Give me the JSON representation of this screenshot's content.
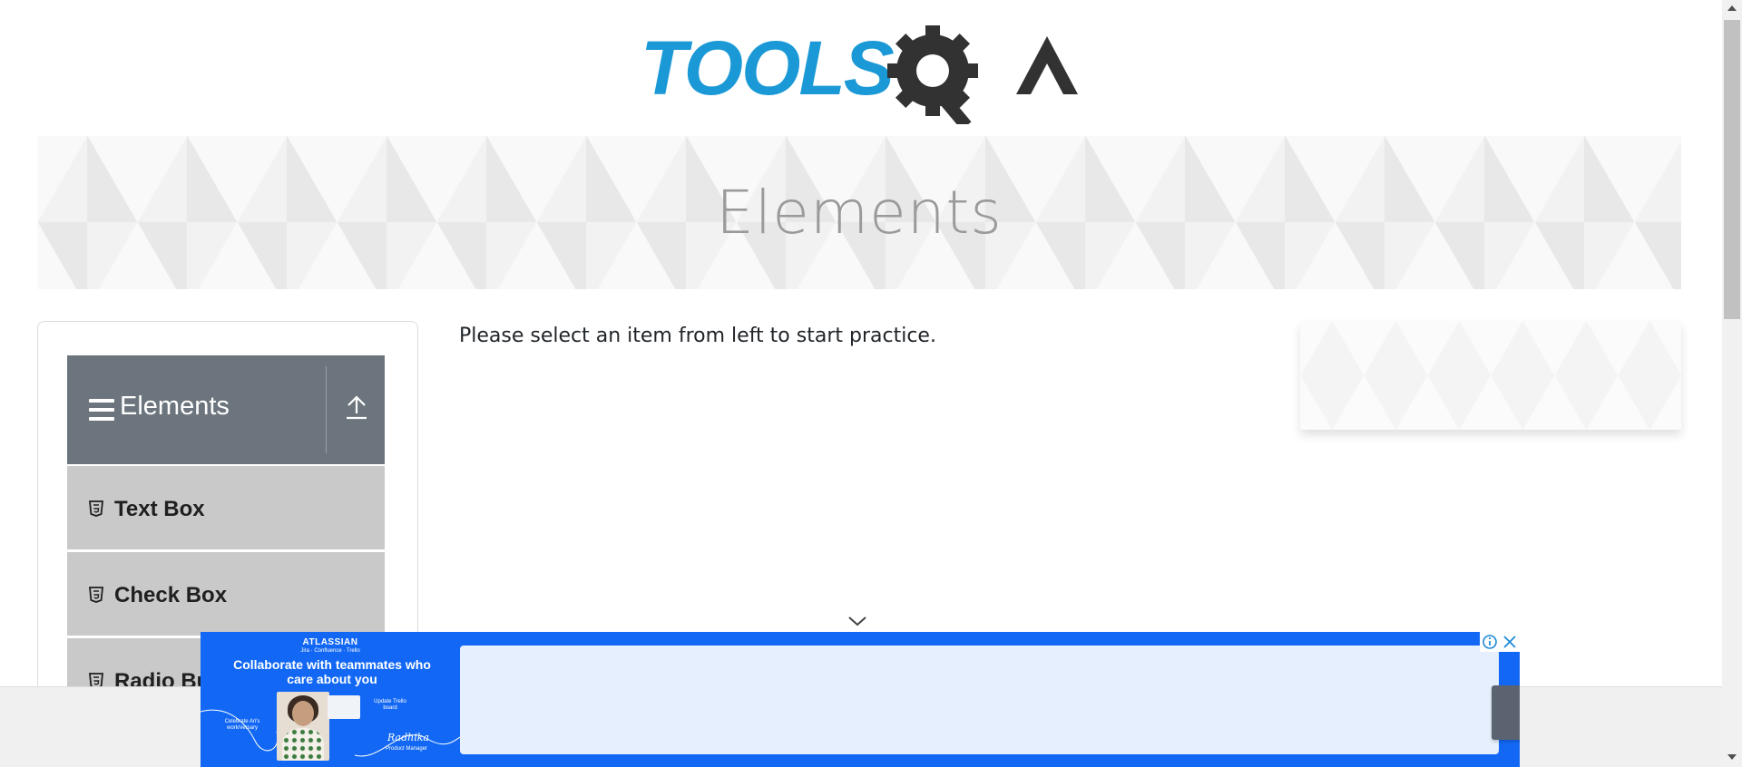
{
  "header": {
    "logo_text": "TOOLSQA"
  },
  "banner": {
    "title": "Elements"
  },
  "sidebar": {
    "group": {
      "title": "Elements"
    },
    "items": [
      {
        "label": "Text Box"
      },
      {
        "label": "Check Box"
      },
      {
        "label": "Radio Button"
      }
    ]
  },
  "main": {
    "practice_text": "Please select an item from left to start practice."
  },
  "ad": {
    "brand": "ATLASSIAN",
    "sub_brand": "Jira · Confluence · Trello",
    "headline": "Collaborate with teammates who care about you",
    "tag_left": "Celebrate Ari's work/versary",
    "tag_right": "Update Trello board",
    "signature": "Radhika",
    "role": "Product Manager",
    "info_icon": "info-icon",
    "close_icon": "close-icon"
  },
  "colors": {
    "logo_blue": "#1a99d6",
    "logo_dark": "#323232",
    "sidebar_header": "#6c757d",
    "sidebar_item": "#c9c9c9",
    "ad_blue": "#1268f4"
  }
}
